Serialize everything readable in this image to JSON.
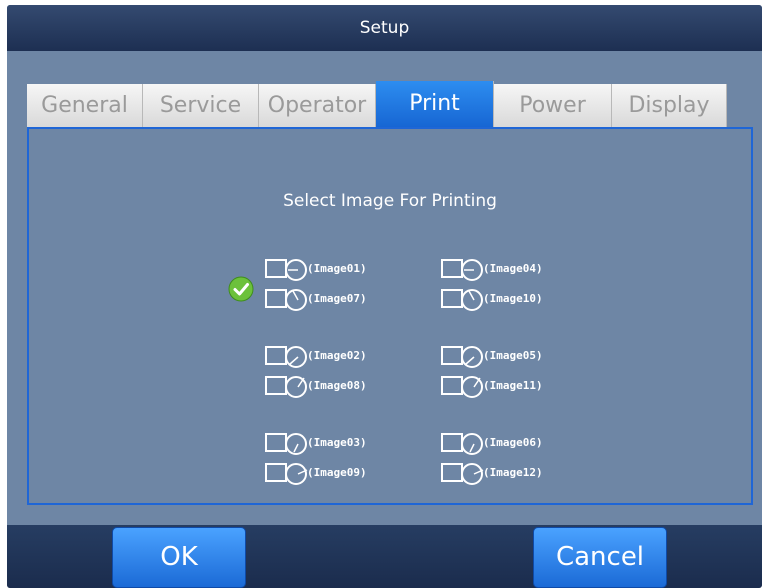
{
  "window": {
    "title": "Setup"
  },
  "tabs": [
    {
      "label": "General",
      "active": false
    },
    {
      "label": "Service",
      "active": false
    },
    {
      "label": "Operator",
      "active": false
    },
    {
      "label": "Print",
      "active": true
    },
    {
      "label": "Power",
      "active": false
    },
    {
      "label": "Display",
      "active": false
    }
  ],
  "panel": {
    "title": "Select Image For Printing"
  },
  "images": [
    {
      "label": "(Image01)",
      "icon": "image-thumbnail-icon",
      "selected": true
    },
    {
      "label": "(Image04)",
      "icon": "image-thumbnail-icon",
      "selected": false
    },
    {
      "label": "(Image07)",
      "icon": "image-thumbnail-icon",
      "selected": false
    },
    {
      "label": "(Image10)",
      "icon": "image-thumbnail-icon",
      "selected": false
    },
    {
      "label": "(Image02)",
      "icon": "image-thumbnail-icon",
      "selected": false
    },
    {
      "label": "(Image05)",
      "icon": "image-thumbnail-icon",
      "selected": false
    },
    {
      "label": "(Image08)",
      "icon": "image-thumbnail-icon",
      "selected": false
    },
    {
      "label": "(Image11)",
      "icon": "image-thumbnail-icon",
      "selected": false
    },
    {
      "label": "(Image03)",
      "icon": "image-thumbnail-icon",
      "selected": false
    },
    {
      "label": "(Image06)",
      "icon": "image-thumbnail-icon",
      "selected": false
    },
    {
      "label": "(Image09)",
      "icon": "image-thumbnail-icon",
      "selected": false
    },
    {
      "label": "(Image12)",
      "icon": "image-thumbnail-icon",
      "selected": false
    }
  ],
  "buttons": {
    "ok": "OK",
    "cancel": "Cancel"
  },
  "colors": {
    "accent": "#1f66d6",
    "background": "#6e86a5",
    "check": "#6cc13b"
  }
}
